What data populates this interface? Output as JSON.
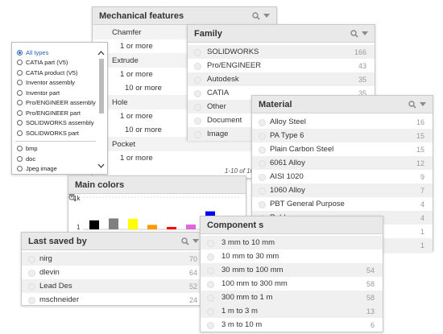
{
  "types_filter": {
    "selected": "All types",
    "options": [
      "CATIA part (V5)",
      "CATIA product (V5)",
      "Inventor assembly",
      "Inventor part",
      "Pro/ENGINEER assembly",
      "Pro/ENGINEER part",
      "SOLIDWORKS assembly",
      "SOLIDWORKS part"
    ],
    "extensions": [
      "bmp",
      "doc",
      "Jpeg image"
    ]
  },
  "mechanical": {
    "title": "Mechanical features",
    "groups": [
      {
        "label": "Chamfer",
        "items": [
          "1 or more"
        ]
      },
      {
        "label": "Extrude",
        "items": [
          "1 or more",
          "10 or more"
        ]
      },
      {
        "label": "Hole",
        "items": [
          "1 or more",
          "10 or more"
        ]
      },
      {
        "label": "Pocket",
        "items": [
          "1 or more"
        ]
      }
    ],
    "pager": "1-10 of 16"
  },
  "family": {
    "title": "Family",
    "items": [
      {
        "label": "SOLIDWORKS",
        "count": "166"
      },
      {
        "label": "Pro/ENGINEER",
        "count": "43"
      },
      {
        "label": "Autodesk",
        "count": "35"
      },
      {
        "label": "CATIA",
        "count": "35"
      },
      {
        "label": "Other",
        "count": ""
      },
      {
        "label": "Document",
        "count": ""
      },
      {
        "label": "Image",
        "count": ""
      }
    ]
  },
  "material": {
    "title": "Material",
    "items": [
      {
        "label": "Alloy Steel",
        "count": "16"
      },
      {
        "label": "PA Type 6",
        "count": "15"
      },
      {
        "label": "Plain Carbon Steel",
        "count": "15"
      },
      {
        "label": "6061 Alloy",
        "count": "12"
      },
      {
        "label": "AISI 1020",
        "count": "9"
      },
      {
        "label": "1060 Alloy",
        "count": "7"
      },
      {
        "label": "PBT General Purpose",
        "count": "4"
      },
      {
        "label": "Rubber",
        "count": "4"
      },
      {
        "label": "Acrylic (Medium-high impact)",
        "count": "1"
      },
      {
        "label": "AISI 304",
        "count": "1"
      }
    ]
  },
  "colors": {
    "title": "Main colors",
    "y_top": "1k",
    "y_bottom": "1"
  },
  "chart_data": {
    "type": "bar",
    "title": "Main colors",
    "categories": [
      "black",
      "gray",
      "yellow",
      "orange",
      "red",
      "magenta",
      "blue"
    ],
    "values": [
      280,
      340,
      330,
      140,
      60,
      150,
      560
    ],
    "colors": [
      "#000000",
      "#7f7f7f",
      "#ffff00",
      "#ff9900",
      "#ff0000",
      "#e066e0",
      "#0000ff"
    ],
    "ylabel": "",
    "yticks": [
      "1",
      "1k"
    ]
  },
  "lastsaved": {
    "title": "Last saved by",
    "items": [
      {
        "label": "nirg",
        "count": "70"
      },
      {
        "label": "dlevin",
        "count": "64"
      },
      {
        "label": "Lead Des",
        "count": "52"
      },
      {
        "label": "mschneider",
        "count": "24"
      }
    ]
  },
  "component": {
    "title": "Component s",
    "items": [
      {
        "label": "3 mm to 10 mm",
        "count": ""
      },
      {
        "label": "10 mm to 30 mm",
        "count": ""
      },
      {
        "label": "30 mm to 100 mm",
        "count": "54"
      },
      {
        "label": "100 mm to 300 mm",
        "count": "58"
      },
      {
        "label": "300 mm to 1 m",
        "count": "58"
      },
      {
        "label": "1 m to 3 m",
        "count": "13"
      },
      {
        "label": "3 m to 10 m",
        "count": "6"
      }
    ]
  }
}
